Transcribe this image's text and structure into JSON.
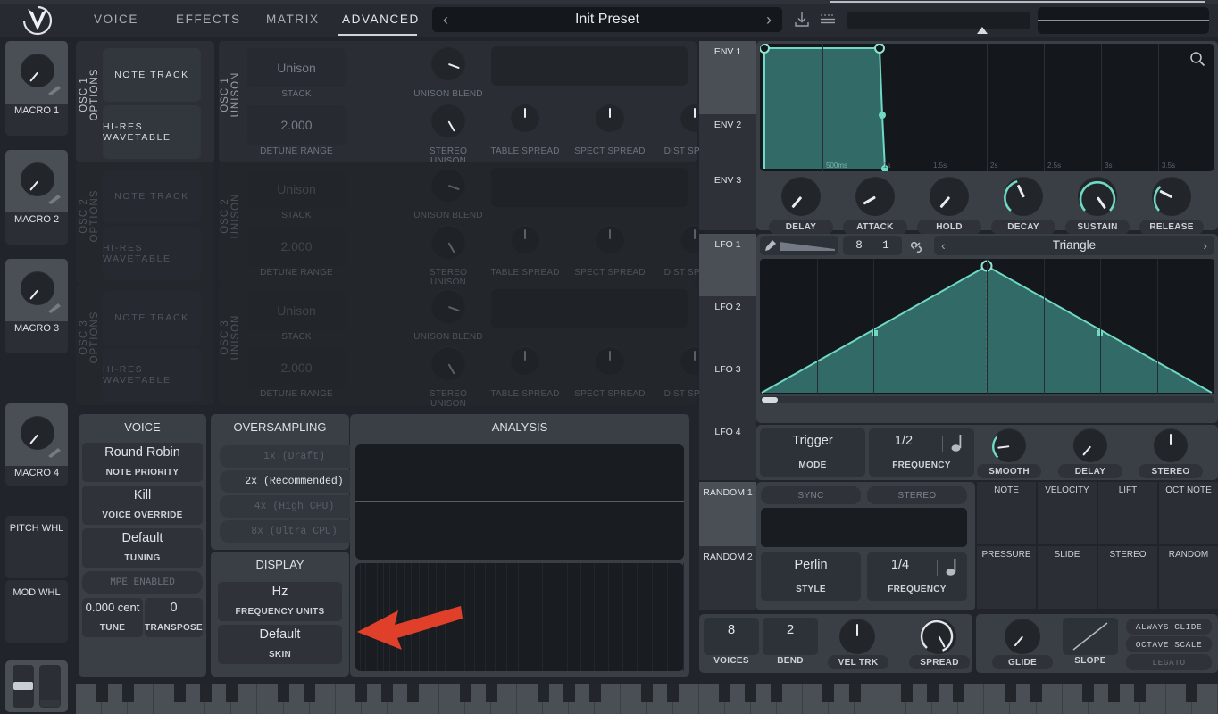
{
  "app": {
    "title": "Vital",
    "logo_icon": "vital-logo-icon"
  },
  "topbar": {
    "tabs": [
      {
        "label": "VOICE",
        "active": false
      },
      {
        "label": "EFFECTS",
        "active": false
      },
      {
        "label": "MATRIX",
        "active": false
      },
      {
        "label": "ADVANCED",
        "active": true
      }
    ],
    "preset": {
      "name": "Init Preset",
      "prev_icon": "chevron-left-icon",
      "next_icon": "chevron-right-icon"
    },
    "download_icon": "download-icon",
    "menu_icon": "hamburger-menu-icon",
    "bend_slider_label": "pitch-bend-slider",
    "oscilloscope_label": "oscilloscope"
  },
  "macros": [
    {
      "name": "MACRO 1"
    },
    {
      "name": "MACRO 2"
    },
    {
      "name": "MACRO 3"
    },
    {
      "name": "MACRO 4"
    }
  ],
  "wheels": [
    {
      "name": "PITCH WHL"
    },
    {
      "name": "MOD WHL"
    }
  ],
  "oscillators": [
    {
      "options_title": "OSC 1 OPTIONS",
      "unison_title": "OSC 1 UNISON",
      "note_track": "NOTE  TRACK",
      "hi_res": "HI-RES WAVETABLE",
      "stack_value": "Unison",
      "stack_label": "STACK",
      "detune_value": "2.000",
      "detune_label": "DETUNE RANGE",
      "knobs": [
        "UNISON BLEND",
        "STEREO UNISON",
        "TABLE SPREAD",
        "SPECT SPREAD",
        "DIST SPREAD"
      ],
      "active": true
    },
    {
      "options_title": "OSC 2 OPTIONS",
      "unison_title": "OSC 2 UNISON",
      "note_track": "NOTE  TRACK",
      "hi_res": "HI-RES WAVETABLE",
      "stack_value": "Unison",
      "stack_label": "STACK",
      "detune_value": "2.000",
      "detune_label": "DETUNE RANGE",
      "knobs": [
        "UNISON BLEND",
        "STEREO UNISON",
        "TABLE SPREAD",
        "SPECT SPREAD",
        "DIST SPREAD"
      ],
      "active": false
    },
    {
      "options_title": "OSC 3 OPTIONS",
      "unison_title": "OSC 3 UNISON",
      "note_track": "NOTE  TRACK",
      "hi_res": "HI-RES WAVETABLE",
      "stack_value": "Unison",
      "stack_label": "STACK",
      "detune_value": "2.000",
      "detune_label": "DETUNE RANGE",
      "knobs": [
        "UNISON BLEND",
        "STEREO UNISON",
        "TABLE SPREAD",
        "SPECT SPREAD",
        "DIST SPREAD"
      ],
      "active": false
    }
  ],
  "voice_section": {
    "title": "VOICE",
    "note_priority": {
      "value": "Round Robin",
      "label": "NOTE PRIORITY"
    },
    "voice_override": {
      "value": "Kill",
      "label": "VOICE OVERRIDE"
    },
    "tuning": {
      "value": "Default",
      "label": "TUNING"
    },
    "mpe": {
      "label": "MPE ENABLED",
      "enabled": false
    },
    "tune": {
      "value": "0.000 cent",
      "label": "TUNE"
    },
    "transpose": {
      "value": "0",
      "label": "TRANSPOSE"
    }
  },
  "oversampling_section": {
    "title": "OVERSAMPLING",
    "options": [
      {
        "label": "1x (Draft)",
        "selected": false
      },
      {
        "label": "2x (Recommended)",
        "selected": true
      },
      {
        "label": "4x (High CPU)",
        "selected": false
      },
      {
        "label": "8x (Ultra CPU)",
        "selected": false
      }
    ]
  },
  "display_section": {
    "title": "DISPLAY",
    "frequency_units": {
      "value": "Hz",
      "label": "FREQUENCY UNITS"
    },
    "skin": {
      "value": "Default",
      "label": "SKIN"
    }
  },
  "analysis_section": {
    "title": "ANALYSIS",
    "arrow_annotation": "red-arrow-pointing-left"
  },
  "modulation_tabs": {
    "envelopes": [
      {
        "label": "ENV 1",
        "selected": true
      },
      {
        "label": "ENV 2",
        "selected": false
      },
      {
        "label": "ENV 3",
        "selected": false
      }
    ],
    "lfos": [
      {
        "label": "LFO 1",
        "selected": true
      },
      {
        "label": "LFO 2",
        "selected": false
      },
      {
        "label": "LFO 3",
        "selected": false
      },
      {
        "label": "LFO 4",
        "selected": false
      }
    ],
    "randoms": [
      {
        "label": "RANDOM 1",
        "selected": true
      },
      {
        "label": "RANDOM 2",
        "selected": false
      }
    ]
  },
  "envelope": {
    "search_icon": "search-icon",
    "time_ticks": [
      "500ms",
      "1s",
      "1.5s",
      "2s",
      "2.5s",
      "3s",
      "3.5s"
    ],
    "knobs": [
      {
        "label": "DELAY",
        "value": 0.0
      },
      {
        "label": "ATTACK",
        "value": 0.0
      },
      {
        "label": "HOLD",
        "value": 0.0
      },
      {
        "label": "DECAY",
        "value": 0.42
      },
      {
        "label": "SUSTAIN",
        "value": 1.0
      },
      {
        "label": "RELEASE",
        "value": 0.2
      }
    ]
  },
  "lfo": {
    "paint_icon": "paint-brush-icon",
    "grid_value": "8  -  1",
    "link_icon": "link-icon",
    "shape": {
      "name": "Triangle",
      "prev_icon": "chevron-left-icon",
      "next_icon": "chevron-right-icon"
    },
    "mode": {
      "value": "Trigger",
      "label": "MODE"
    },
    "frequency": {
      "value": "1/2",
      "label": "FREQUENCY",
      "note_icon": "quarter-note-icon"
    },
    "knobs": [
      {
        "label": "SMOOTH",
        "value": 0.12
      },
      {
        "label": "DELAY",
        "value": 0.0
      },
      {
        "label": "STEREO",
        "value": 0.5
      }
    ]
  },
  "random": {
    "sync_label": "SYNC",
    "stereo_label": "STEREO",
    "style": {
      "value": "Perlin",
      "label": "STYLE"
    },
    "frequency": {
      "value": "1/4",
      "label": "FREQUENCY",
      "note_icon": "quarter-note-icon"
    }
  },
  "mod_sources": [
    "NOTE",
    "VELOCITY",
    "LIFT",
    "OCT NOTE",
    "PRESSURE",
    "SLIDE",
    "STEREO",
    "RANDOM"
  ],
  "voice_controls": {
    "voices": {
      "value": "8",
      "label": "VOICES"
    },
    "bend": {
      "value": "2",
      "label": "BEND"
    },
    "vel_trk": {
      "label": "VEL TRK",
      "value": 0.5
    },
    "spread": {
      "label": "SPREAD",
      "value": 0.82
    }
  },
  "glide_controls": {
    "glide": {
      "label": "GLIDE",
      "value": 0.0
    },
    "slope": {
      "label": "SLOPE"
    },
    "buttons": [
      {
        "label": "ALWAYS GLIDE",
        "enabled": true
      },
      {
        "label": "OCTAVE SCALE",
        "enabled": true
      },
      {
        "label": "LEGATO",
        "enabled": false
      }
    ]
  },
  "colors": {
    "accent": "#6fd9c3",
    "arrow": "#e0402a",
    "panel": "#3a3e45",
    "background": "#21252b",
    "text": "#dfe3e8"
  }
}
